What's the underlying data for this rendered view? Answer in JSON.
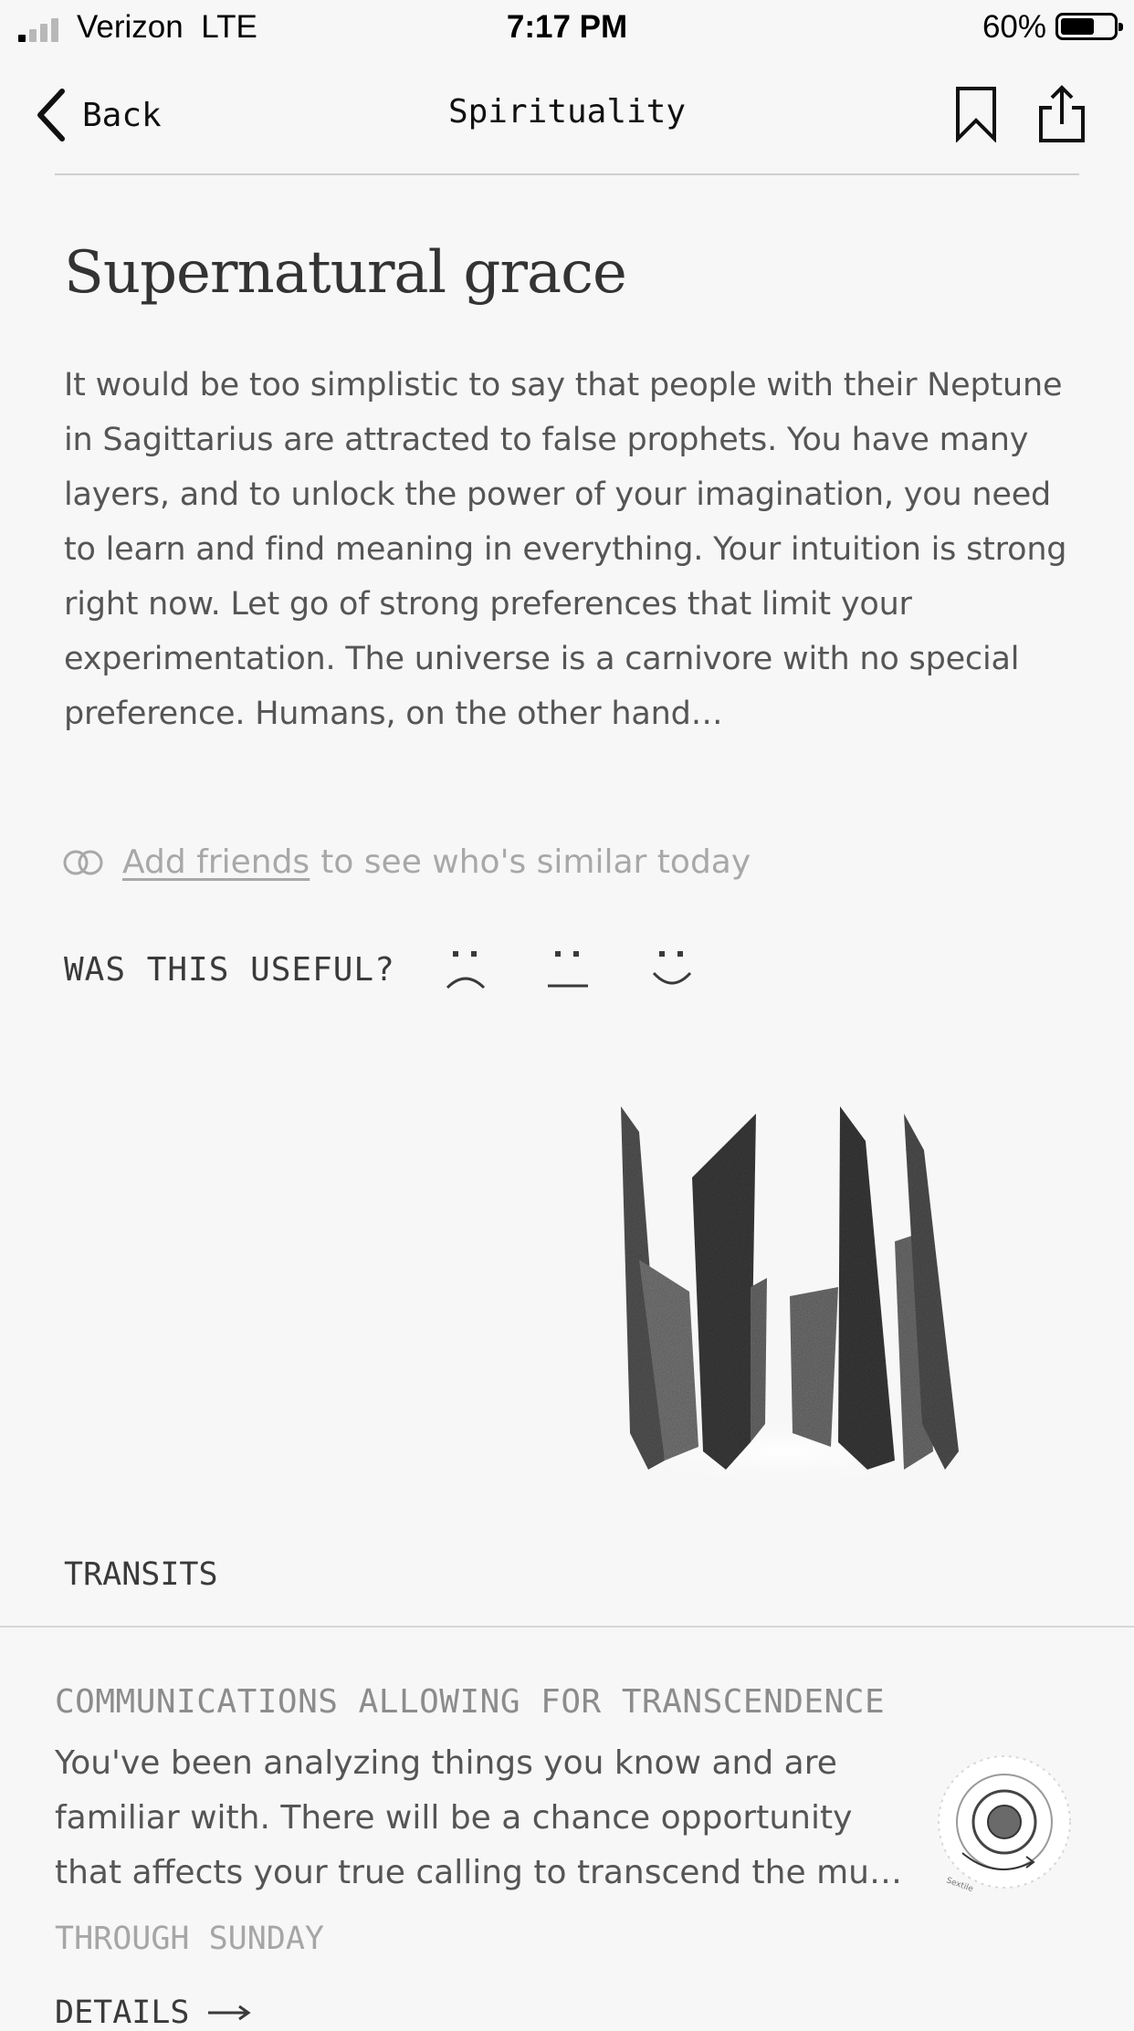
{
  "status_bar": {
    "carrier": "Verizon",
    "network": "LTE",
    "time": "7:17 PM",
    "battery_percent": "60%",
    "battery_level": 0.6,
    "signal_bars_active": 1
  },
  "nav": {
    "back_label": "Back",
    "title": "Spirituality",
    "bookmark_icon": "bookmark-icon",
    "share_icon": "share-icon"
  },
  "article": {
    "title": "Supernatural grace",
    "body": "It would be too simplistic to say that people with their Neptune in Sagittarius are attracted to false prophets. You have many layers, and to unlock the power of your imagination, you need to learn and find meaning in everything. Your intuition is strong right now. Let go of strong preferences that limit your experimentation. The universe is a carnivore with no special preference. Humans, on the other hand…"
  },
  "friends": {
    "icon": "overlapping-circles-icon",
    "link_label": "Add friends",
    "rest": "to see who's similar today"
  },
  "feedback": {
    "question": "WAS THIS USEFUL?",
    "options": [
      "sad-face-icon",
      "neutral-face-icon",
      "happy-face-icon"
    ]
  },
  "transits": {
    "section_label": "TRANSITS",
    "item": {
      "title": "COMMUNICATIONS ALLOWING FOR TRANSCENDENCE",
      "body": "You've been analyzing things you know and are familiar with. There will be a chance opportunity that affects your true calling to transcend the mu…",
      "date": "THROUGH SUNDAY",
      "details_label": "DETAILS"
    }
  },
  "colors": {
    "background": "#f7f7f7",
    "text": "#3a3a3a",
    "muted": "#a8a8a8"
  }
}
